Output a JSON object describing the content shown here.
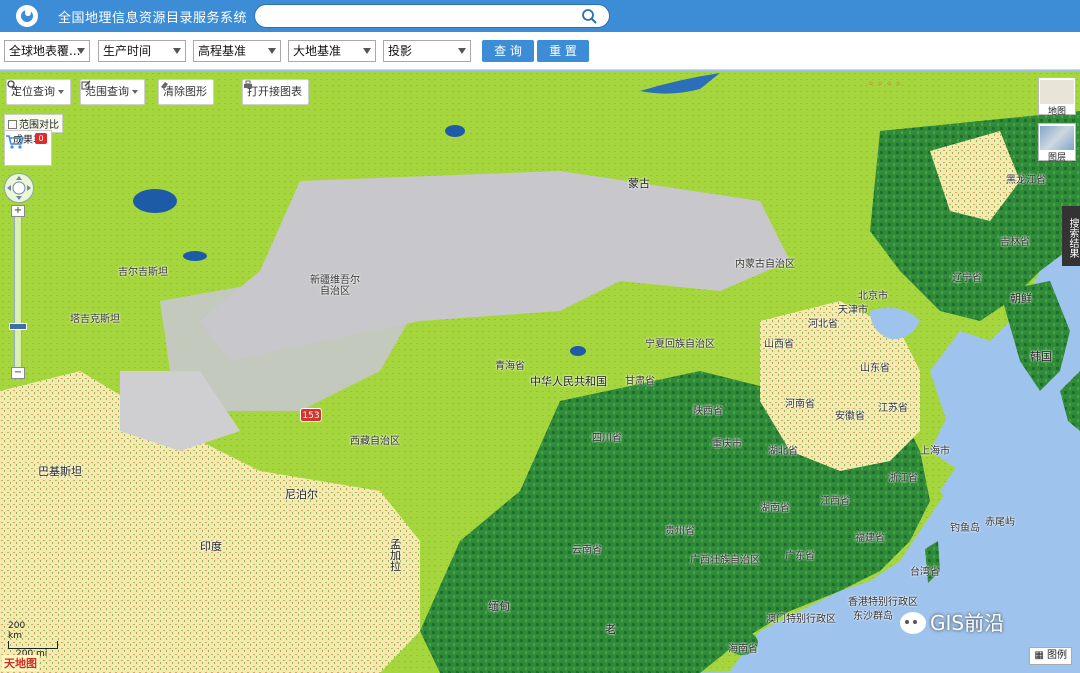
{
  "header": {
    "title": "全国地理信息资源目录服务系统",
    "search_placeholder": ""
  },
  "filters": {
    "selects": [
      "全球地表覆...",
      "生产时间",
      "高程基准",
      "大地基准",
      "投影"
    ],
    "query_label": "查 询",
    "reset_label": "重 置"
  },
  "map_tools": {
    "locate": "定位查询",
    "range": "范围查询",
    "clear": "清除图形",
    "open_chart": "打开接图表",
    "compare": "范围对比",
    "cart": "成果车",
    "cart_count": "0",
    "road_badge": "153"
  },
  "map_switch": {
    "map": "地图",
    "layer": "图层"
  },
  "search_results_tab": "搜索结果",
  "legend_label": "图例",
  "scale": {
    "km": "200\nkm",
    "mi": "200 mi"
  },
  "watermark": "GIS前沿",
  "tianditu": "天地图",
  "labels": [
    {
      "id": "mongolia",
      "text": "蒙古",
      "cls": "big"
    },
    {
      "id": "kyrgyz",
      "text": "吉尔吉斯坦",
      "cls": ""
    },
    {
      "id": "tajik",
      "text": "塔吉克斯坦",
      "cls": ""
    },
    {
      "id": "xinjiang",
      "text": "新疆维吾尔\n自治区",
      "cls": ""
    },
    {
      "id": "neimenggu",
      "text": "内蒙古自治区",
      "cls": ""
    },
    {
      "id": "heilongjiang",
      "text": "黑龙江省",
      "cls": ""
    },
    {
      "id": "jilin",
      "text": "吉林省",
      "cls": ""
    },
    {
      "id": "liaoning",
      "text": "辽宁省",
      "cls": ""
    },
    {
      "id": "korea",
      "text": "朝鲜",
      "cls": "big"
    },
    {
      "id": "skorea",
      "text": "韩国",
      "cls": "big"
    },
    {
      "id": "beijing",
      "text": "北京市",
      "cls": ""
    },
    {
      "id": "tianjin",
      "text": "天津市",
      "cls": ""
    },
    {
      "id": "hebei",
      "text": "河北省",
      "cls": ""
    },
    {
      "id": "shanxi",
      "text": "山西省",
      "cls": ""
    },
    {
      "id": "shandong",
      "text": "山东省",
      "cls": ""
    },
    {
      "id": "ningxia",
      "text": "宁夏回族自治区",
      "cls": ""
    },
    {
      "id": "qinghai",
      "text": "青海省",
      "cls": ""
    },
    {
      "id": "prc",
      "text": "中华人民共和国",
      "cls": "big"
    },
    {
      "id": "gansu",
      "text": "甘肃省",
      "cls": ""
    },
    {
      "id": "henan",
      "text": "河南省",
      "cls": ""
    },
    {
      "id": "shaanxi",
      "text": "陕西省",
      "cls": ""
    },
    {
      "id": "anhui",
      "text": "安徽省",
      "cls": ""
    },
    {
      "id": "jiangsu",
      "text": "江苏省",
      "cls": ""
    },
    {
      "id": "shanghai",
      "text": "上海市",
      "cls": ""
    },
    {
      "id": "xizang",
      "text": "西藏自治区",
      "cls": ""
    },
    {
      "id": "sichuan",
      "text": "四川省",
      "cls": ""
    },
    {
      "id": "chongqing",
      "text": "重庆市",
      "cls": ""
    },
    {
      "id": "hubei",
      "text": "湖北省",
      "cls": ""
    },
    {
      "id": "zhejiang",
      "text": "浙江省",
      "cls": ""
    },
    {
      "id": "jiangxi",
      "text": "江西省",
      "cls": ""
    },
    {
      "id": "hunan",
      "text": "湖南省",
      "cls": ""
    },
    {
      "id": "guizhou",
      "text": "贵州省",
      "cls": ""
    },
    {
      "id": "fujian",
      "text": "福建省",
      "cls": ""
    },
    {
      "id": "yunnan",
      "text": "云南省",
      "cls": ""
    },
    {
      "id": "guangxi",
      "text": "广西壮族自治区",
      "cls": ""
    },
    {
      "id": "guangdong",
      "text": "广东省",
      "cls": ""
    },
    {
      "id": "taiwan",
      "text": "台湾省",
      "cls": ""
    },
    {
      "id": "diaoyu",
      "text": "钓鱼岛",
      "cls": ""
    },
    {
      "id": "chiwei",
      "text": "赤尾屿",
      "cls": ""
    },
    {
      "id": "hongkong",
      "text": "香港特别行政区",
      "cls": ""
    },
    {
      "id": "macao",
      "text": "澳门特别行政区",
      "cls": ""
    },
    {
      "id": "dongsha",
      "text": "东沙群岛",
      "cls": ""
    },
    {
      "id": "hainan",
      "text": "海南省",
      "cls": ""
    },
    {
      "id": "pakistan",
      "text": "巴基斯坦",
      "cls": "big"
    },
    {
      "id": "nepal",
      "text": "尼泊尔",
      "cls": "big"
    },
    {
      "id": "india",
      "text": "印度",
      "cls": "big"
    },
    {
      "id": "bangla",
      "text": "孟\n加\n拉",
      "cls": "big"
    },
    {
      "id": "myanmar",
      "text": "缅甸",
      "cls": "big"
    },
    {
      "id": "laos",
      "text": "老",
      "cls": "big"
    }
  ]
}
